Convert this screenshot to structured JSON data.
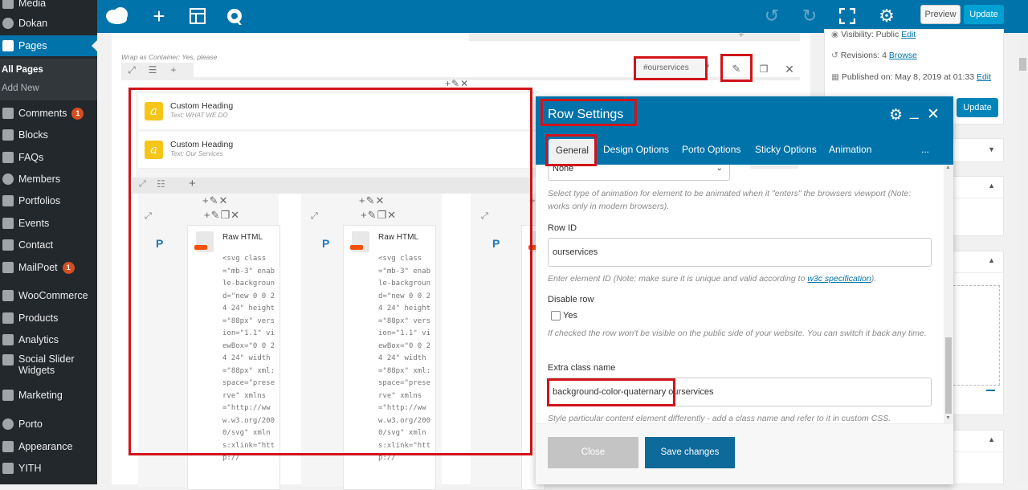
{
  "sidebar": {
    "items": [
      {
        "label": "Media"
      },
      {
        "label": "Dokan"
      },
      {
        "label": "Pages"
      },
      {
        "label": "Comments",
        "badge": "1"
      },
      {
        "label": "Blocks"
      },
      {
        "label": "FAQs"
      },
      {
        "label": "Members"
      },
      {
        "label": "Portfolios"
      },
      {
        "label": "Events"
      },
      {
        "label": "Contact"
      },
      {
        "label": "MailPoet",
        "badge": "1"
      },
      {
        "label": "WooCommerce"
      },
      {
        "label": "Products"
      },
      {
        "label": "Analytics"
      },
      {
        "label": "Social Slider Widgets"
      },
      {
        "label": "Marketing"
      },
      {
        "label": "Porto"
      },
      {
        "label": "Appearance"
      },
      {
        "label": "YITH"
      }
    ],
    "submenu": [
      {
        "label": "All Pages"
      },
      {
        "label": "Add New"
      }
    ]
  },
  "toolbar": {
    "preview_label": "Preview",
    "update_label": "Update"
  },
  "editor": {
    "container_label": "Wrap as Container: Yes, please",
    "row_id_badge": "#ourservices",
    "elements": [
      {
        "title": "Custom Heading",
        "subtitle": "Text: WHAT WE DO"
      },
      {
        "title": "Custom Heading",
        "subtitle": "Text: Our Services"
      }
    ],
    "raw_html_title": "Raw HTML",
    "raw_html_code": "<svg class=\"mb-3\" enable-background=\"new 0 0 24 24\" height=\"88px\" version=\"1.1\" viewBox=\"0 0 24 24\" width=\"88px\" xml:space=\"preserve\" xmlns=\"http://www.w3.org/2000/svg\" xmlns:xlink=\"http://",
    "column_icon": "P"
  },
  "publish": {
    "visibility": "Visibility: Public",
    "visibility_link": "Edit",
    "revisions": "Revisions: 4",
    "revisions_link": "Browse",
    "published": "Published on: May 8, 2019 at 01:33",
    "published_link": "Edit",
    "update_label": "Update"
  },
  "modal": {
    "title": "Row Settings",
    "tabs": [
      "General",
      "Design Options",
      "Porto Options",
      "Sticky Options",
      "Animation"
    ],
    "more": "...",
    "animation_select": "None",
    "animation_desc": "Select type of animation for element to be animated when it \"enters\" the browsers viewport (Note: works only in modern browsers).",
    "row_id_label": "Row ID",
    "row_id_value": "ourservices",
    "row_id_desc_prefix": "Enter element ID (Note: make sure it is unique and valid according to ",
    "row_id_desc_link": "w3c specification",
    "row_id_desc_suffix": ").",
    "disable_label": "Disable row",
    "disable_checkbox": "Yes",
    "disable_desc": "If checked the row won't be visible on the public side of your website. You can switch it back any time.",
    "extra_class_label": "Extra class name",
    "extra_class_value": "background-color-quaternary ourservices",
    "extra_class_desc": "Style particular content element differently - add a class name and refer to it in custom CSS.",
    "close_label": "Close",
    "save_label": "Save changes"
  },
  "colors": {
    "wp_blue": "#0073aa",
    "highlight_red": "#d0141a",
    "sidebar_dark": "#23282d"
  }
}
